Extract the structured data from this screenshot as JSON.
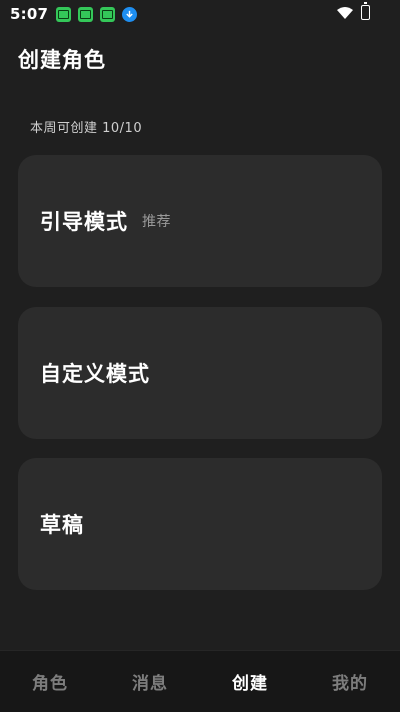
{
  "status_bar": {
    "time": "5:07",
    "icons": [
      "app-notification-icon",
      "app-notification-icon",
      "app-notification-icon",
      "download-icon",
      "wifi-icon",
      "battery-icon"
    ]
  },
  "header": {
    "title": "创建角色",
    "quota": "本周可创建 10/10"
  },
  "cards": [
    {
      "title": "引导模式",
      "tag": "推荐"
    },
    {
      "title": "自定义模式",
      "tag": ""
    },
    {
      "title": "草稿",
      "tag": ""
    }
  ],
  "bottom_nav": {
    "items": [
      {
        "label": "角色",
        "active": false
      },
      {
        "label": "消息",
        "active": false
      },
      {
        "label": "创建",
        "active": true
      },
      {
        "label": "我的",
        "active": false
      }
    ]
  },
  "colors": {
    "background": "#1f1f1f",
    "card": "#2c2c2c",
    "nav_background": "#171717",
    "active_text": "#ffffff",
    "inactive_text": "#7d7d7d"
  }
}
